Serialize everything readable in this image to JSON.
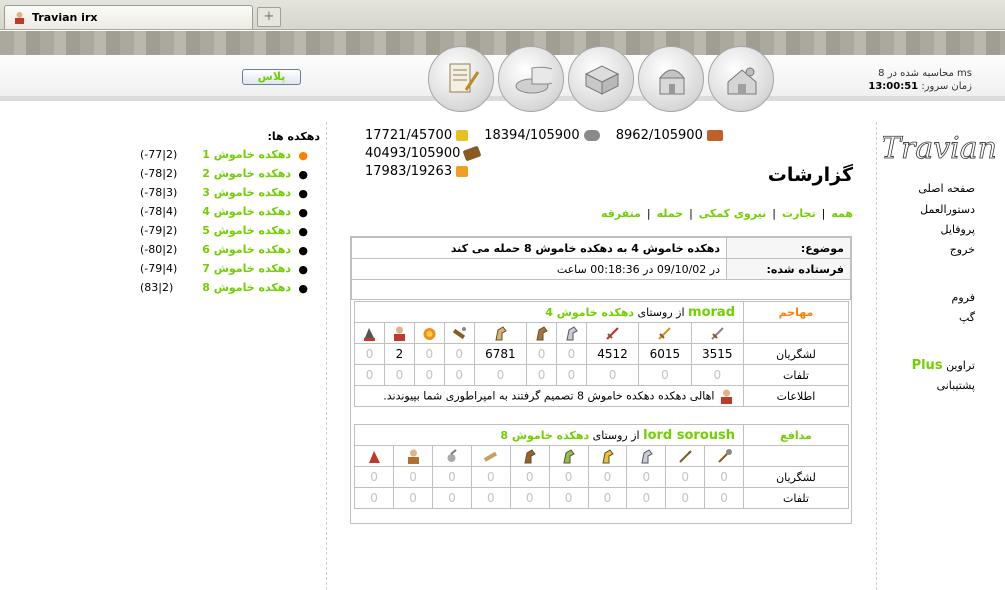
{
  "browser": {
    "tab_title": "Travian irx",
    "new_tab_symbol": "+"
  },
  "header": {
    "plus_button": "پلاس",
    "server_time_line": "محاسبه شده در 8 ms",
    "server_clock_label": "زمان سرور:",
    "server_clock": "13:00:51",
    "nav_icons": [
      "village-overview-icon",
      "village-center-icon",
      "map-icon",
      "statistics-icon",
      "reports-icon"
    ]
  },
  "villages": {
    "title": "دهکده ها:",
    "items": [
      {
        "name": "دهکده خاموش 1",
        "coords": "(-77|2)",
        "active": true
      },
      {
        "name": "دهکده خاموش 2",
        "coords": "(-78|2)",
        "active": false
      },
      {
        "name": "دهکده خاموش 3",
        "coords": "(-78|3)",
        "active": false
      },
      {
        "name": "دهکده خاموش 4",
        "coords": "(-78|4)",
        "active": false
      },
      {
        "name": "دهکده خاموش 5",
        "coords": "(-79|2)",
        "active": false
      },
      {
        "name": "دهکده خاموش 6",
        "coords": "(-80|2)",
        "active": false
      },
      {
        "name": "دهکده خاموش 7",
        "coords": "(-79|4)",
        "active": false
      },
      {
        "name": "دهکده خاموش 8",
        "coords": "(83|2)",
        "active": false
      }
    ]
  },
  "resources": {
    "lumber": "40493/105900",
    "clay": "8962/105900",
    "iron": "18394/105900",
    "crop": "17721/45700",
    "consumption": "17983/19263"
  },
  "page": {
    "title": "گزارشات",
    "filters": [
      "همه",
      "تجارت",
      "نیروی کمکی",
      "حمله",
      "متفرقه"
    ]
  },
  "report": {
    "subject_label": "موضوع:",
    "subject": "دهکده خاموش 4 به دهکده خاموش 8 حمله می کند",
    "sent_label": "فرستاده شده:",
    "sent_value": "در 09/10/02 در 00:18:36 ساعت",
    "attacker": {
      "role": "مهاجم",
      "player": "morad",
      "from_text": "از روستای",
      "village": "دهکده خاموش 4",
      "troops_label": "لشگریان",
      "troops": [
        "3515",
        "6015",
        "4512",
        "0",
        "0",
        "6781",
        "0",
        "0",
        "2",
        "0"
      ],
      "losses_label": "تلفات",
      "losses": [
        "0",
        "0",
        "0",
        "0",
        "0",
        "0",
        "0",
        "0",
        "0",
        "0"
      ],
      "info_label": "اطلاعات",
      "info_text": "اهالی دهکده دهکده خاموش 8 تصمیم گرفتند به امپراطوری شما بپیوندند."
    },
    "defender": {
      "role": "مدافع",
      "player": "lord soroush",
      "from_text": "از روستای",
      "village": "دهکده خاموش 8",
      "troops_label": "لشگریان",
      "troops": [
        "0",
        "0",
        "0",
        "0",
        "0",
        "0",
        "0",
        "0",
        "0",
        "0"
      ],
      "losses_label": "تلفات",
      "losses": [
        "0",
        "0",
        "0",
        "0",
        "0",
        "0",
        "0",
        "0",
        "0",
        "0"
      ]
    }
  },
  "right_menu": {
    "logo_text": "Travian",
    "items": [
      "صفحه اصلی",
      "دستورالعمل",
      "پروفایل",
      "خروج",
      "فروم",
      "گپ"
    ],
    "plus_prefix": "تراوین",
    "plus_word": "Plus",
    "support": "پشتیبانی"
  },
  "colors": {
    "accent_green": "#71d000",
    "role_orange": "#ff8000"
  }
}
